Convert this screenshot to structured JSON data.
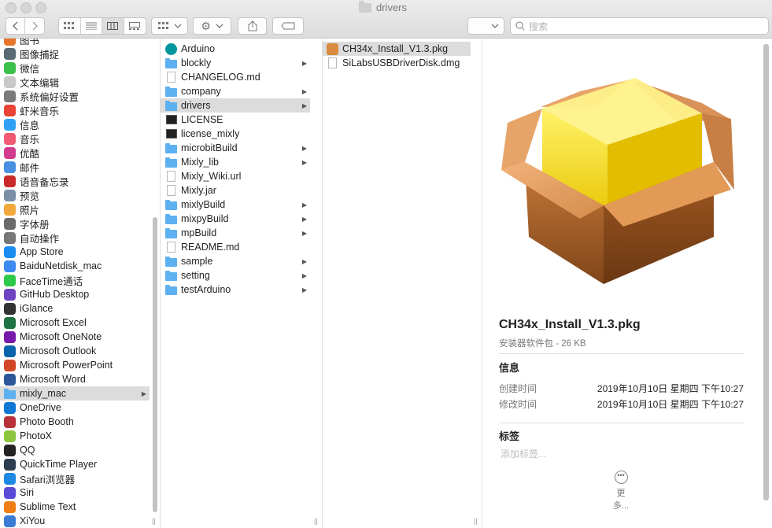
{
  "window": {
    "title": "drivers"
  },
  "toolbar": {
    "back_icon": "chevron-left-icon",
    "forward_icon": "chevron-right-icon",
    "search_placeholder": "搜索"
  },
  "sidebar": {
    "items": [
      {
        "label": "图书",
        "icon": "book-icon",
        "color": "#e8752c"
      },
      {
        "label": "图像捕捉",
        "icon": "camera-icon",
        "color": "#5a6b74"
      },
      {
        "label": "微信",
        "icon": "wechat-icon",
        "color": "#3cc14a"
      },
      {
        "label": "文本编辑",
        "icon": "textedit-icon",
        "color": "#c8c8c8"
      },
      {
        "label": "系统偏好设置",
        "icon": "gear-icon",
        "color": "#7a7a7a"
      },
      {
        "label": "虾米音乐",
        "icon": "xiami-icon",
        "color": "#e84336"
      },
      {
        "label": "信息",
        "icon": "messages-icon",
        "color": "#2fa0f5"
      },
      {
        "label": "音乐",
        "icon": "music-icon",
        "color": "#f05a73"
      },
      {
        "label": "优酷",
        "icon": "youku-icon",
        "color": "#d33b8d"
      },
      {
        "label": "邮件",
        "icon": "mail-icon",
        "color": "#4a90e2"
      },
      {
        "label": "语音备忘录",
        "icon": "voice-memo-icon",
        "color": "#c92a2a"
      },
      {
        "label": "预览",
        "icon": "preview-icon",
        "color": "#7a8fa6"
      },
      {
        "label": "照片",
        "icon": "photos-icon",
        "color": "#f2a93b"
      },
      {
        "label": "字体册",
        "icon": "fontbook-icon",
        "color": "#6b6b6b"
      },
      {
        "label": "自动操作",
        "icon": "automator-icon",
        "color": "#777777"
      },
      {
        "label": "App Store",
        "icon": "app-store-icon",
        "color": "#1b8df2"
      },
      {
        "label": "BaiduNetdisk_mac",
        "icon": "baidu-netdisk-icon",
        "color": "#3d8bf0"
      },
      {
        "label": "FaceTime通话",
        "icon": "facetime-icon",
        "color": "#2fc94a"
      },
      {
        "label": "GitHub Desktop",
        "icon": "github-icon",
        "color": "#6f42c1"
      },
      {
        "label": "iGlance",
        "icon": "iglance-icon",
        "color": "#333333"
      },
      {
        "label": "Microsoft Excel",
        "icon": "excel-icon",
        "color": "#1f7244"
      },
      {
        "label": "Microsoft OneNote",
        "icon": "onenote-icon",
        "color": "#7719aa"
      },
      {
        "label": "Microsoft Outlook",
        "icon": "outlook-icon",
        "color": "#0a64ad"
      },
      {
        "label": "Microsoft PowerPoint",
        "icon": "powerpoint-icon",
        "color": "#d24726"
      },
      {
        "label": "Microsoft Word",
        "icon": "word-icon",
        "color": "#2b579a"
      },
      {
        "label": "mixly_mac",
        "icon": "folder-icon",
        "color": "#5eb1f0",
        "selected": true,
        "folder": true
      },
      {
        "label": "OneDrive",
        "icon": "onedrive-icon",
        "color": "#0f78d4"
      },
      {
        "label": "Photo Booth",
        "icon": "photo-booth-icon",
        "color": "#b8323a"
      },
      {
        "label": "PhotoX",
        "icon": "photox-icon",
        "color": "#8cc63f"
      },
      {
        "label": "QQ",
        "icon": "qq-icon",
        "color": "#222222"
      },
      {
        "label": "QuickTime Player",
        "icon": "quicktime-icon",
        "color": "#2c3e50"
      },
      {
        "label": "Safari浏览器",
        "icon": "safari-icon",
        "color": "#1e88e5"
      },
      {
        "label": "Siri",
        "icon": "siri-icon",
        "color": "#5c4bd6"
      },
      {
        "label": "Sublime Text",
        "icon": "sublime-icon",
        "color": "#f07d16"
      },
      {
        "label": "XiYou",
        "icon": "xiyou-icon",
        "color": "#3a7bd5"
      }
    ]
  },
  "column2": {
    "items": [
      {
        "label": "Arduino",
        "kind": "app",
        "icon": "arduino-icon"
      },
      {
        "label": "blockly",
        "kind": "folder",
        "icon": "folder-icon",
        "arrow": true
      },
      {
        "label": "CHANGELOG.md",
        "kind": "doc",
        "icon": "document-icon"
      },
      {
        "label": "company",
        "kind": "folder",
        "icon": "folder-icon",
        "arrow": true
      },
      {
        "label": "drivers",
        "kind": "folder",
        "icon": "folder-icon",
        "arrow": true,
        "selected": true
      },
      {
        "label": "LICENSE",
        "kind": "term",
        "icon": "terminal-icon"
      },
      {
        "label": "license_mixly",
        "kind": "term",
        "icon": "terminal-icon"
      },
      {
        "label": "microbitBuild",
        "kind": "folder",
        "icon": "folder-icon",
        "arrow": true
      },
      {
        "label": "Mixly_lib",
        "kind": "folder",
        "icon": "folder-icon",
        "arrow": true
      },
      {
        "label": "Mixly_Wiki.url",
        "kind": "doc",
        "icon": "url-document-icon"
      },
      {
        "label": "Mixly.jar",
        "kind": "doc",
        "icon": "jar-icon"
      },
      {
        "label": "mixlyBuild",
        "kind": "folder",
        "icon": "folder-icon",
        "arrow": true
      },
      {
        "label": "mixpyBuild",
        "kind": "folder",
        "icon": "folder-icon",
        "arrow": true
      },
      {
        "label": "mpBuild",
        "kind": "folder",
        "icon": "folder-icon",
        "arrow": true
      },
      {
        "label": "README.md",
        "kind": "doc",
        "icon": "document-icon"
      },
      {
        "label": "sample",
        "kind": "folder",
        "icon": "folder-icon",
        "arrow": true
      },
      {
        "label": "setting",
        "kind": "folder",
        "icon": "folder-icon",
        "arrow": true
      },
      {
        "label": "testArduino",
        "kind": "folder",
        "icon": "folder-icon",
        "arrow": true
      }
    ]
  },
  "column3": {
    "items": [
      {
        "label": "CH34x_Install_V1.3.pkg",
        "icon": "package-icon",
        "selected": true
      },
      {
        "label": "SiLabsUSBDriverDisk.dmg",
        "icon": "disk-image-icon"
      }
    ]
  },
  "preview": {
    "name": "CH34x_Install_V1.3.pkg",
    "type": "安装器软件包 - 26 KB",
    "info_heading": "信息",
    "created_label": "创建时间",
    "created_value": "2019年10月10日 星期四 下午10:27",
    "modified_label": "修改时间",
    "modified_value": "2019年10月10日 星期四 下午10:27",
    "tags_heading": "标签",
    "tags_placeholder": "添加标签...",
    "more_label": "更多..."
  }
}
